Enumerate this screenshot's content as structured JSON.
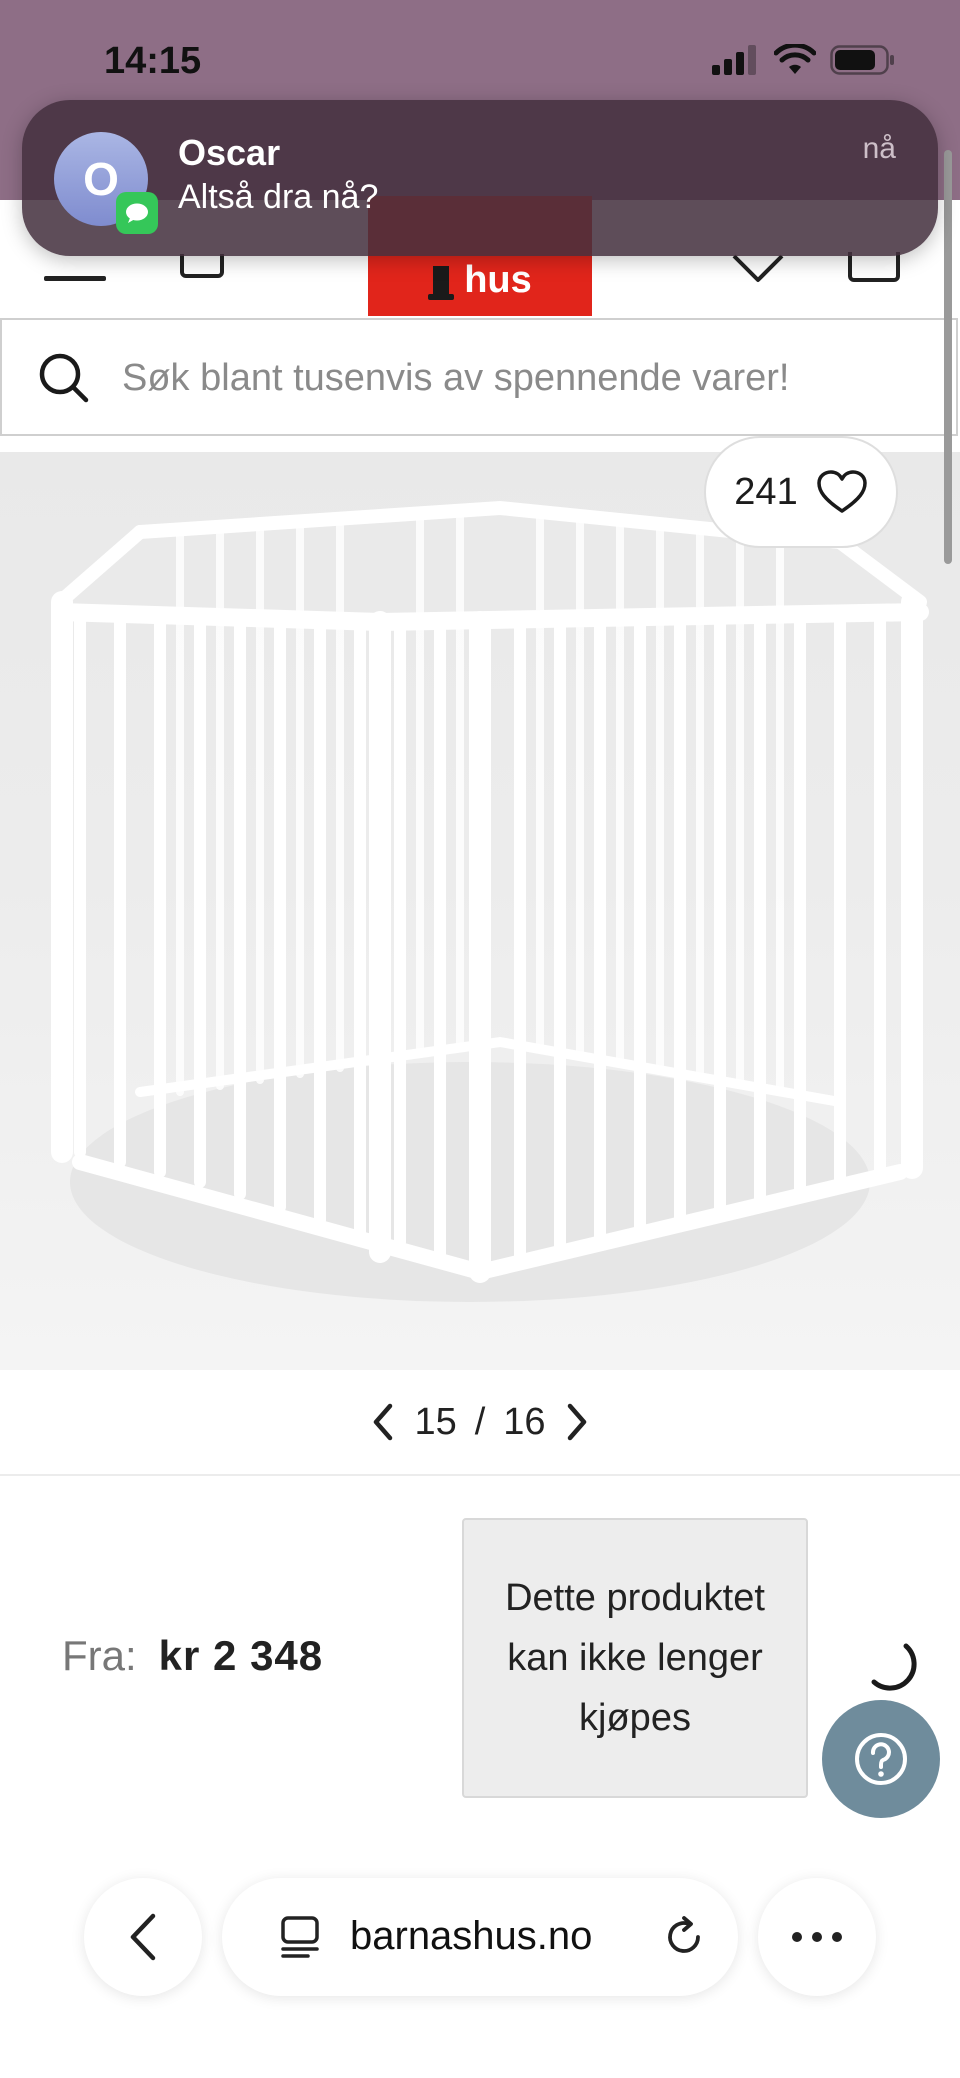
{
  "status_bar": {
    "time": "14:15"
  },
  "notification": {
    "avatar_initial": "O",
    "sender": "Oscar",
    "message": "Altså dra nå?",
    "time": "nå"
  },
  "header": {
    "logo_text": "hus"
  },
  "search": {
    "placeholder": "Søk blant tusenvis av spennende varer!"
  },
  "product": {
    "favorites_count": "241",
    "image_index": "15",
    "image_total": "16",
    "pager_separator": "/",
    "price_label": "Fra:",
    "price_value": "kr 2 348",
    "availability_message": "Dette produktet kan ikke lenger kjøpes"
  },
  "browser": {
    "url": "barnashus.no"
  },
  "colors": {
    "brand_red": "#e1251b",
    "help_button": "#6f8c9c",
    "status_bar": "#8e6e86"
  }
}
